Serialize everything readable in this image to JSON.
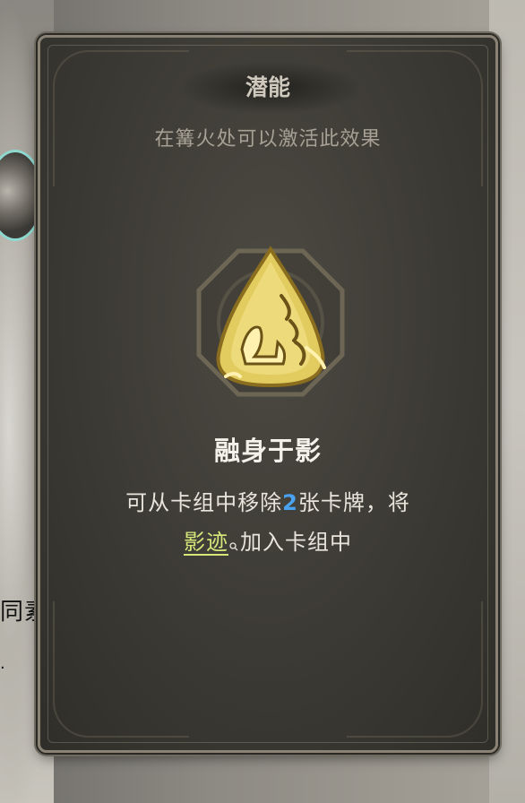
{
  "background": {
    "partial_text_1": "同素",
    "partial_text_2": "."
  },
  "card": {
    "title": "潜能",
    "subtitle": "在篝火处可以激活此效果",
    "emblem_icon": "golden-shadow-rune-icon",
    "ability_name": "融身于影",
    "description": {
      "line1_prefix": "可从卡组中移除",
      "line1_number": "2",
      "line1_suffix": "张卡牌，将",
      "line2_keyword": "影迹",
      "line2_suffix": "加入卡组中"
    },
    "colors": {
      "number": "#4aa3f0",
      "keyword": "#d7e87a",
      "emblem_gold": "#e8d36a"
    }
  }
}
